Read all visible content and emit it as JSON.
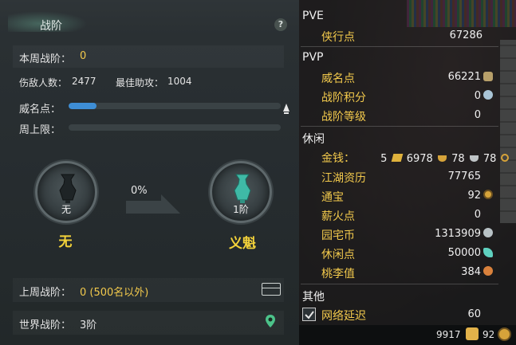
{
  "panel": {
    "title": "战阶",
    "help": "?",
    "weekly_rank_label": "本周战阶：",
    "weekly_rank_value": "0",
    "kills_label": "伤敌人数：",
    "kills_value": "2477",
    "assist_label": "最佳助攻：",
    "assist_value": "1004",
    "prestige_label": "威名点：",
    "prestige_progress": 0.13,
    "weekly_cap_label": "周上限：",
    "weekly_cap_progress": 0,
    "current_badge": {
      "caption": "无",
      "name": "无"
    },
    "next_badge": {
      "caption": "1阶",
      "name": "义魁"
    },
    "progress_pct": "0%",
    "last_rank_label": "上周战阶：",
    "last_rank_value": "0 (500名以外)",
    "world_rank_label": "世界战阶：",
    "world_rank_value": "3阶"
  },
  "stats": {
    "pve": {
      "header": "PVE",
      "items": [
        {
          "label": "侠行点",
          "value": "67286"
        }
      ]
    },
    "pvp": {
      "header": "PVP",
      "items": [
        {
          "label": "威名点",
          "value": "66221"
        },
        {
          "label": "战阶积分",
          "value": "0"
        },
        {
          "label": "战阶等级",
          "value": "0"
        }
      ]
    },
    "leisure": {
      "header": "休闲",
      "money_label": "金钱：",
      "money_gold": "5",
      "money_silver": "6978",
      "money_copper": "78",
      "money_other": "78",
      "items": [
        {
          "label": "江湖资历",
          "value": "77765"
        },
        {
          "label": "通宝",
          "value": "92"
        },
        {
          "label": "薪火点",
          "value": "0"
        },
        {
          "label": "园宅币",
          "value": "1313909"
        },
        {
          "label": "休闲点",
          "value": "50000"
        },
        {
          "label": "桃李值",
          "value": "384"
        }
      ]
    },
    "other": {
      "header": "其他",
      "items": [
        {
          "label": "网络延迟",
          "value": "60",
          "checked": true
        }
      ]
    }
  },
  "footer": {
    "value_1": "9917",
    "value_2": "92"
  },
  "colors": {
    "label_gold": "#f2c94c",
    "prestige_bar": "#3e8ed6",
    "badge_teal": "#3fb9a6"
  },
  "icons": [
    "help-icon",
    "prestige-marker-icon",
    "vase-badge-icon",
    "chest-icon",
    "location-pin-icon",
    "checkbox-icon",
    "gold-ingot-icon",
    "coin-icon"
  ]
}
